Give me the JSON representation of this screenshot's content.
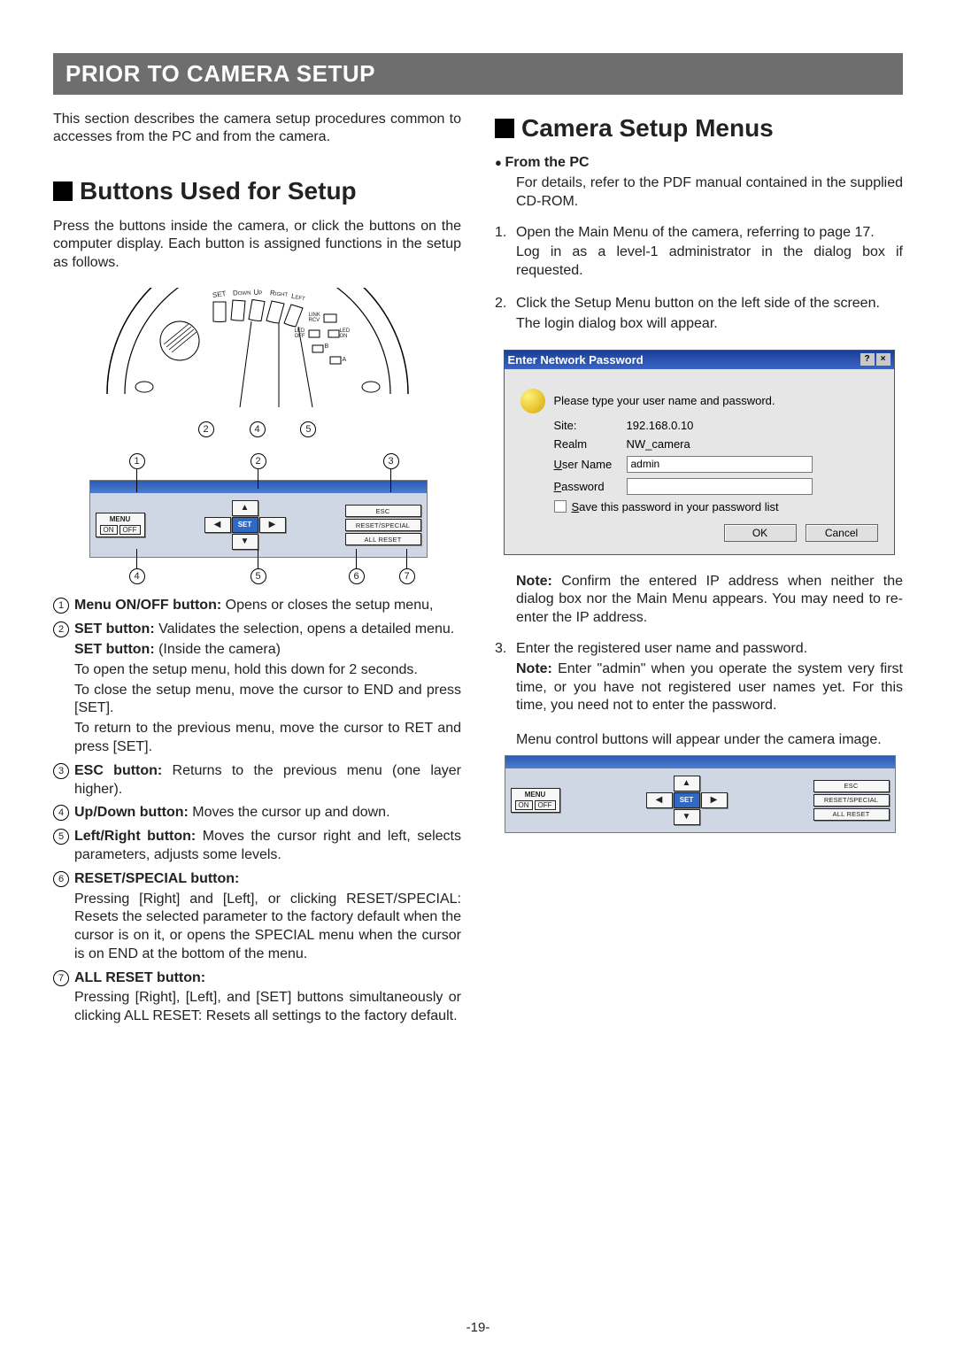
{
  "banner": "PRIOR TO CAMERA SETUP",
  "intro": "This section describes the camera setup procedures common to accesses from the PC and from the camera.",
  "left": {
    "heading": "Buttons Used for Setup",
    "body": "Press the buttons inside the camera, or click the buttons on the computer display. Each button is assigned functions in the setup as follows.",
    "dome_labels": {
      "set": "SET",
      "down": "DOWN",
      "up": "UP",
      "right": "RIGHT",
      "left": "LEFT",
      "linkrcv": "LINK\nRCV",
      "ledoff": "LED\nOFF",
      "ledon": "LED\nON",
      "a": "A",
      "b": "B"
    },
    "dome_callouts": [
      "2",
      "4",
      "5"
    ],
    "panel": {
      "menu": "MENU",
      "on": "ON",
      "off": "OFF",
      "set": "SET",
      "esc": "ESC",
      "reset_special": "RESET/SPECIAL",
      "all_reset": "ALL RESET"
    },
    "top_callouts": [
      "1",
      "2",
      "3"
    ],
    "bot_callouts": [
      "4",
      "5",
      "6",
      "7"
    ],
    "items": [
      {
        "title": "Menu ON/OFF button:",
        "text": " Opens or closes the setup menu,"
      },
      {
        "title": "SET button:",
        "text": " Validates the selection, opens a detailed menu.",
        "extras": [
          {
            "b": "SET button:",
            "t": " (Inside the camera)"
          },
          {
            "t": "To open the setup menu, hold this down for 2 seconds."
          },
          {
            "t": "To close the setup menu, move the cursor to END and press [SET]."
          },
          {
            "t": "To return to the previous menu, move the cursor to RET and press [SET]."
          }
        ]
      },
      {
        "title": "ESC button:",
        "text": " Returns to the previous menu (one layer higher)."
      },
      {
        "title": "Up/Down button:",
        "text": " Moves the cursor up and down."
      },
      {
        "title": "Left/Right button:",
        "text": " Moves the cursor right and left, selects parameters, adjusts some levels."
      },
      {
        "title": "RESET/SPECIAL button:",
        "text": "",
        "extras": [
          {
            "t": "Pressing [Right] and [Left], or clicking RESET/SPECIAL: Resets the selected parameter to the factory default when the cursor is on it, or opens the SPECIAL menu when the cursor is on END at the bottom of the menu."
          }
        ]
      },
      {
        "title": "ALL RESET button:",
        "text": "",
        "extras": [
          {
            "t": "Pressing [Right], [Left], and [SET] buttons simultaneously or clicking ALL RESET: Resets all settings to the factory default."
          }
        ]
      }
    ]
  },
  "right": {
    "heading": "Camera Setup Menus",
    "from_pc": "From the PC",
    "from_pc_body": "For details, refer to the PDF manual contained in the supplied CD-ROM.",
    "steps": [
      {
        "text": "Open the Main Menu of the camera, referring to page 17.",
        "follow": "Log in as a level-1 administrator in the dialog box if requested."
      },
      {
        "text": "Click the Setup Menu button on the left side of the screen.",
        "follow": "The login dialog box will appear."
      }
    ],
    "dialog": {
      "title": "Enter Network Password",
      "prompt": "Please type your user name and password.",
      "site_label": "Site:",
      "site_value": "192.168.0.10",
      "realm_label": "Realm",
      "realm_value": "NW_camera",
      "user_label": "User Name",
      "user_value": "admin",
      "pass_label": "Password",
      "pass_value": "",
      "save": "Save this password in your password list",
      "ok": "OK",
      "cancel": "Cancel"
    },
    "note1_head": "Note:",
    "note1_body": " Confirm the entered IP address when neither the dialog box nor the Main Menu appears. You may need to re-enter the IP address.",
    "step3_text": "Enter the registered user name and password.",
    "step3_note_head": "Note:",
    "step3_note_body": " Enter \"admin\" when you operate the system very first time, or you have not registered user names yet. For this time, you need not to enter the password.",
    "step3_follow": "Menu control buttons will appear under the camera image."
  },
  "page_number": "-19-"
}
